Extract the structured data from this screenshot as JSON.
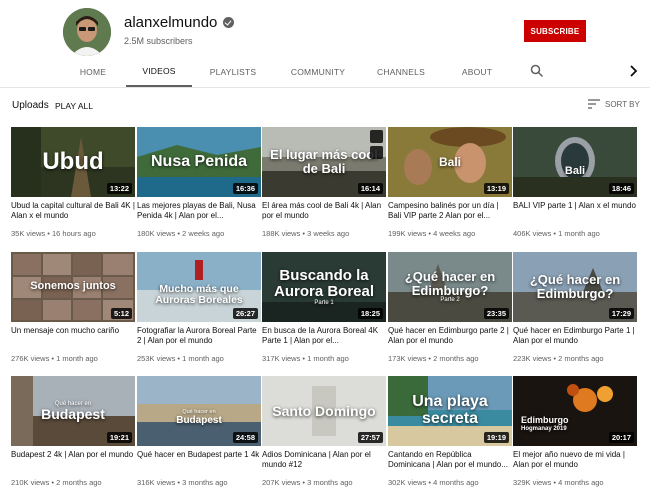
{
  "channel": {
    "name": "alanxelmundo",
    "subscribers": "2.5M subscribers",
    "subscribe_label": "SUBSCRIBE"
  },
  "tabs": [
    {
      "label": "HOME"
    },
    {
      "label": "VIDEOS"
    },
    {
      "label": "PLAYLISTS"
    },
    {
      "label": "COMMUNITY"
    },
    {
      "label": "CHANNELS"
    },
    {
      "label": "ABOUT"
    }
  ],
  "active_tab": "VIDEOS",
  "icons": {
    "search": "search-icon",
    "next": "chevron-right-icon",
    "sort": "sort-icon",
    "verified": "verified-check-icon"
  },
  "uploads": {
    "label": "Uploads",
    "play_all": "PLAY ALL",
    "sort_by": "SORT BY"
  },
  "colors": {
    "subscribe": "#cc0000",
    "active_tab_underline": "#606060"
  },
  "videos": [
    {
      "thumb_text": "Ubud",
      "duration": "13:22",
      "title": "Ubud la capital cultural de Bali 4K | Alan x el mundo",
      "meta": "35K views • 16 hours ago"
    },
    {
      "thumb_text": "Nusa Penida",
      "duration": "16:36",
      "title": "Las mejores playas de Bali, Nusa Penida 4k | Alan por el...",
      "meta": "180K views • 2 weeks ago"
    },
    {
      "thumb_text": "El lugar más cool de Bali",
      "duration": "16:14",
      "title": "El área más cool de Bali 4k | Alan por el mundo",
      "meta": "188K views • 3 weeks ago"
    },
    {
      "thumb_text": "Bali",
      "duration": "13:19",
      "title": "Campesino balinés por un día | Bali VIP parte 2 Alan por el...",
      "meta": "199K views • 4 weeks ago"
    },
    {
      "thumb_text": "Bali",
      "duration": "18:46",
      "title": "BALI VIP parte 1 | Alan x el mundo",
      "meta": "406K views • 1 month ago"
    },
    {
      "thumb_text": "Sonemos juntos",
      "duration": "5:12",
      "title": "Un mensaje con mucho cariño",
      "meta": "276K views • 1 month ago"
    },
    {
      "thumb_text": "Mucho más que Auroras Boreales",
      "duration": "26:27",
      "title": "Fotografiar la Aurora Boreal Parte 2 | Alan por el mundo",
      "meta": "253K views • 1 month ago"
    },
    {
      "thumb_text": "Buscando la Aurora Boreal",
      "thumb_sub": "Parte 1",
      "duration": "18:25",
      "title": "En busca de la Aurora Boreal 4K Parte 1 | Alan por el...",
      "meta": "317K views • 1 month ago"
    },
    {
      "thumb_text": "¿Qué hacer en Edimburgo?",
      "thumb_sub": "Parte 2",
      "duration": "23:35",
      "title": "Qué hacer en Edimburgo parte 2 | Alan por el mundo",
      "meta": "173K views • 2 months ago"
    },
    {
      "thumb_text": "¿Qué hacer en Edimburgo?",
      "duration": "17:29",
      "title": "Qué hacer en Edimburgo Parte 1 | Alan por el mundo",
      "meta": "223K views • 2 months ago"
    },
    {
      "thumb_text": "Budapest",
      "thumb_pre": "Qué hacer en",
      "duration": "19:21",
      "title": "Budapest 2 4k | Alan por el mundo",
      "meta": "210K views • 2 months ago"
    },
    {
      "thumb_text": "Budapest",
      "thumb_pre": "Qué hacer en",
      "duration": "24:58",
      "title": "Qué hacer en Budapest parte 1 4k",
      "meta": "316K views • 3 months ago"
    },
    {
      "thumb_text": "Santo Domingo",
      "duration": "27:57",
      "title": "Adios Dominicana | Alan por el mundo #12",
      "meta": "207K views • 3 months ago"
    },
    {
      "thumb_text": "Una playa secreta",
      "duration": "19:19",
      "title": "Cantando en República Dominicana | Alan por el mundo...",
      "meta": "302K views • 4 months ago"
    },
    {
      "thumb_text": "Edimburgo",
      "thumb_sub": "Hogmanay 2019",
      "duration": "20:17",
      "title": "El mejor año nuevo de mi vida | Alan por el mundo",
      "meta": "329K views • 4 months ago"
    }
  ]
}
